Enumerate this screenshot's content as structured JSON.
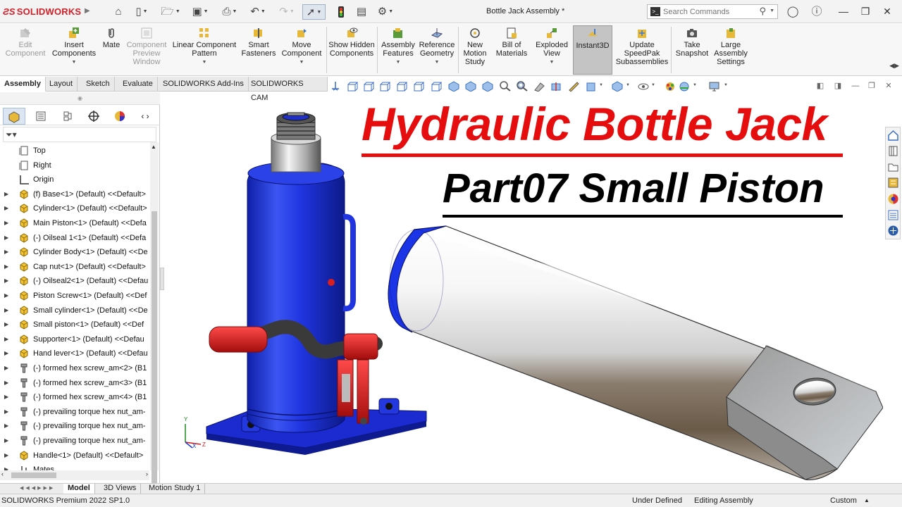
{
  "app": {
    "brand": "SOLIDWORKS",
    "document_title": "Bottle Jack Assembly *",
    "search_placeholder": "Search Commands"
  },
  "command_manager": [
    {
      "label": "Edit Component",
      "enabled": false
    },
    {
      "label": "Insert Components",
      "enabled": true,
      "dropdown": true
    },
    {
      "label": "Mate",
      "enabled": true
    },
    {
      "label": "Component Preview Window",
      "enabled": false
    },
    {
      "label": "Linear Component Pattern",
      "enabled": true,
      "dropdown": true
    },
    {
      "label": "Smart Fasteners",
      "enabled": true
    },
    {
      "label": "Move Component",
      "enabled": true,
      "dropdown": true
    },
    {
      "label": "Show Hidden Components",
      "enabled": true
    },
    {
      "label": "Assembly Features",
      "enabled": true,
      "dropdown": true
    },
    {
      "label": "Reference Geometry",
      "enabled": true,
      "dropdown": true
    },
    {
      "label": "New Motion Study",
      "enabled": true
    },
    {
      "label": "Bill of Materials",
      "enabled": true
    },
    {
      "label": "Exploded View",
      "enabled": true,
      "dropdown": true
    },
    {
      "label": "Instant3D",
      "enabled": true,
      "active": true
    },
    {
      "label": "Update SpeedPak Subassemblies",
      "enabled": true
    },
    {
      "label": "Take Snapshot",
      "enabled": true
    },
    {
      "label": "Large Assembly Settings",
      "enabled": true
    }
  ],
  "cm_tabs": [
    "Assembly",
    "Layout",
    "Sketch",
    "Evaluate",
    "SOLIDWORKS Add-Ins",
    "SOLIDWORKS CAM"
  ],
  "active_cm_tab": "Assembly",
  "feature_tree": [
    {
      "label": "Top",
      "icon": "plane-icon",
      "expandable": false
    },
    {
      "label": "Right",
      "icon": "plane-icon",
      "expandable": false
    },
    {
      "label": "Origin",
      "icon": "origin-icon",
      "expandable": false
    },
    {
      "label": "(f) Base<1> (Default) <<Default>",
      "icon": "part-icon",
      "expandable": true
    },
    {
      "label": "Cylinder<1> (Default) <<Default>",
      "icon": "part-icon",
      "expandable": true
    },
    {
      "label": "Main Piston<1> (Default) <<Defa",
      "icon": "part-icon",
      "expandable": true
    },
    {
      "label": "(-) Oilseal 1<1> (Default) <<Defa",
      "icon": "part-icon",
      "expandable": true
    },
    {
      "label": "Cylinder Body<1> (Default) <<De",
      "icon": "part-icon",
      "expandable": true
    },
    {
      "label": "Cap nut<1> (Default) <<Default>",
      "icon": "part-icon",
      "expandable": true
    },
    {
      "label": "(-) Oilseal2<1> (Default) <<Defau",
      "icon": "part-icon",
      "expandable": true
    },
    {
      "label": "Piston Screw<1> (Default) <<Def",
      "icon": "part-icon",
      "expandable": true
    },
    {
      "label": "Small cylinder<1> (Default) <<De",
      "icon": "part-icon",
      "expandable": true
    },
    {
      "label": "Small piston<1> (Default) <<Def",
      "icon": "part-icon",
      "expandable": true
    },
    {
      "label": "Supporter<1> (Default) <<Defau",
      "icon": "part-icon",
      "expandable": true
    },
    {
      "label": "Hand lever<1> (Default) <<Defau",
      "icon": "part-icon",
      "expandable": true
    },
    {
      "label": "(-) formed hex screw_am<2> (B1",
      "icon": "screw-icon",
      "expandable": true
    },
    {
      "label": "(-) formed hex screw_am<3> (B1",
      "icon": "screw-icon",
      "expandable": true
    },
    {
      "label": "(-) formed hex screw_am<4> (B1",
      "icon": "screw-icon",
      "expandable": true
    },
    {
      "label": "(-) prevailing torque hex nut_am-",
      "icon": "screw-icon",
      "expandable": true
    },
    {
      "label": "(-) prevailing torque hex nut_am-",
      "icon": "screw-icon",
      "expandable": true
    },
    {
      "label": "(-) prevailing torque hex nut_am-",
      "icon": "screw-icon",
      "expandable": true
    },
    {
      "label": "Handle<1> (Default) <<Default>",
      "icon": "part-icon",
      "expandable": true
    },
    {
      "label": "Mates",
      "icon": "mates-icon",
      "expandable": true
    }
  ],
  "bottom_tabs": [
    "Model",
    "3D Views",
    "Motion Study 1"
  ],
  "active_bottom_tab": "Model",
  "status": {
    "version": "SOLIDWORKS Premium 2022 SP1.0",
    "definition": "Under Defined",
    "mode": "Editing Assembly",
    "units": "Custom"
  },
  "viewport": {
    "title": "Hydraulic Bottle Jack",
    "subtitle": "Part07 Small Piston"
  },
  "colors": {
    "brand_red": "#d0202a",
    "title_red": "#e50d0d",
    "jack_blue": "#1b2fd8",
    "handle_red": "#d81e1e",
    "part_yellow": "#f2c230"
  }
}
